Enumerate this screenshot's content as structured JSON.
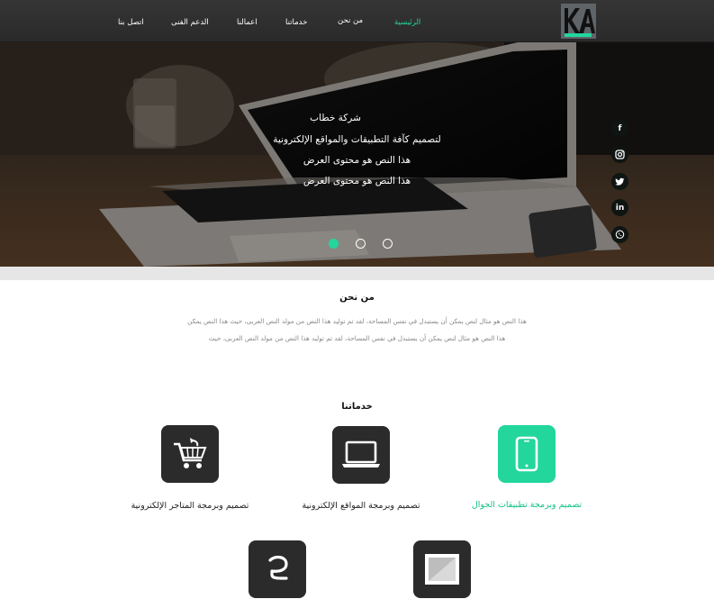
{
  "nav": {
    "logo_text": "KA",
    "items": [
      {
        "label": "الرئيسية",
        "active": true
      },
      {
        "label": "من نحن"
      },
      {
        "label": "خدماتنا"
      },
      {
        "label": "اعمالنا"
      },
      {
        "label": "الدعم الفنى"
      },
      {
        "label": "اتصل بنا"
      }
    ]
  },
  "hero": {
    "lines": [
      "شركة خطاب",
      "لتصميم كآفة التطبيقات والمواقع الإلكترونية",
      "هذا النص هو محتوى العرض",
      "هذا النص هو محتوى العرض"
    ],
    "slides_count": 3,
    "active_slide": 1,
    "social": [
      {
        "icon": "facebook-icon",
        "glyph": "f"
      },
      {
        "icon": "instagram-icon",
        "glyph": "◘"
      },
      {
        "icon": "twitter-icon",
        "glyph": "t"
      },
      {
        "icon": "linkedin-icon",
        "glyph": "in"
      },
      {
        "icon": "whatsapp-icon",
        "glyph": "✆"
      }
    ]
  },
  "about": {
    "title": "من نحن",
    "lines": [
      "هذا النص هو مثال لنص يمكن أن يستبدل في نفس المساحة، لقد تم توليد هذا النص من مولد النص العربى، حيث هذا النص يمكن",
      "هذا النص هو مثال لنص يمكن أن يستبدل في نفس المساحة، لقد تم توليد هذا النص من مولد النص العربى، حيث"
    ]
  },
  "services": {
    "title": "خدماتنا",
    "items": [
      {
        "label": "تصميم وبرمجة تطبيقات الجوال",
        "icon": "mobile-phone-icon",
        "accent": "#22d69c"
      },
      {
        "label": "تصميم وبرمجة المواقع الإلكترونية",
        "icon": "laptop-icon",
        "accent": "#2b2b2b"
      },
      {
        "label": "تصميم وبرمجة المتاجر الإلكترونية",
        "icon": "shopping-cart-icon",
        "accent": "#2b2b2b"
      },
      {
        "label": "",
        "icon": "image-frame-icon",
        "accent": "#2b2b2b"
      },
      {
        "label": "",
        "icon": "arabic-letter-icon",
        "accent": "#2b2b2b"
      }
    ]
  },
  "colors": {
    "accent": "#22d69c",
    "navbar": "#2f2f2f",
    "icon_tile": "#2b2b2b"
  }
}
